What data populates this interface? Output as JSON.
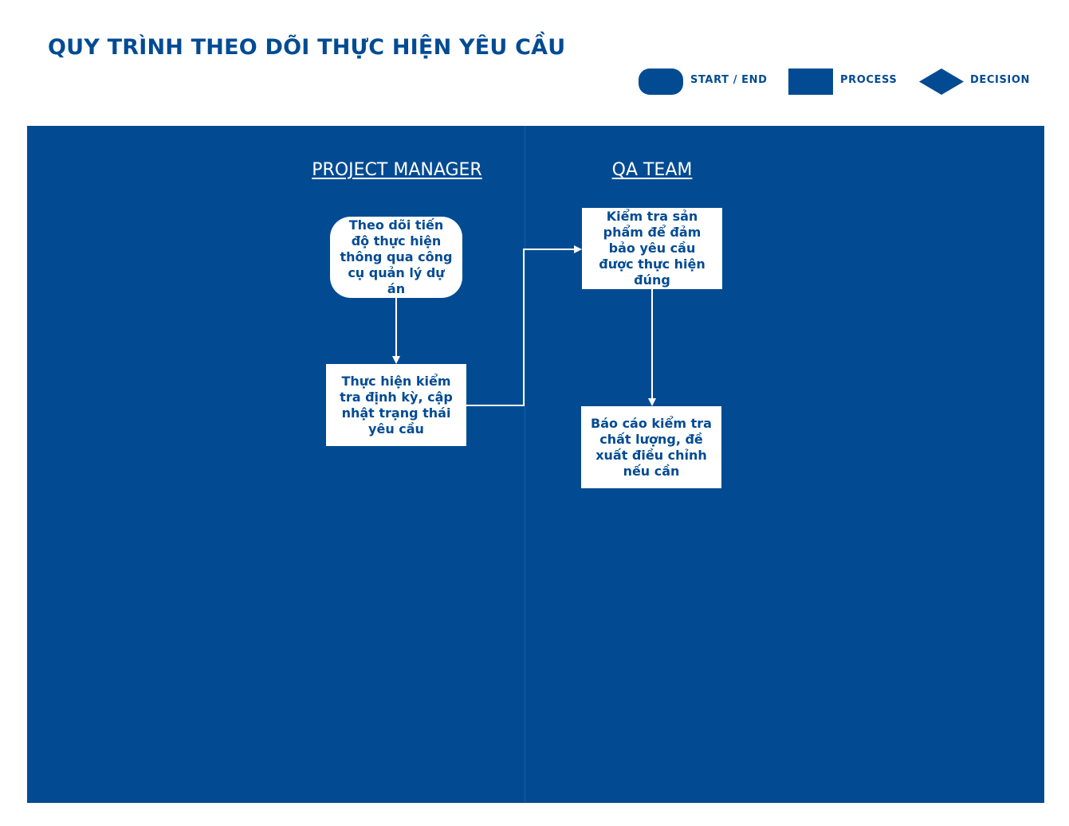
{
  "title": "QUY TRÌNH THEO DÕI THỰC HIỆN YÊU CẦU",
  "legend": {
    "start_end": "START / END",
    "process": "PROCESS",
    "decision": "DECISION"
  },
  "lanes": {
    "project_manager": "PROJECT MANAGER",
    "qa_team": "QA TEAM"
  },
  "nodes": {
    "pm_start": "Theo dõi tiến độ thực hiện thông qua công cụ quản lý dự án",
    "pm_process": "Thực hiện kiểm tra định kỳ, cập nhật trạng thái yêu cầu",
    "qa_check": "Kiểm tra sản phẩm để đảm bảo yêu cầu được thực hiện đúng",
    "qa_report": "Báo cáo kiểm tra chất lượng, đề xuất điều chỉnh nếu cần"
  },
  "colors": {
    "primary": "#024b93",
    "node_fill": "#ffffff",
    "connector": "#ffffff"
  }
}
